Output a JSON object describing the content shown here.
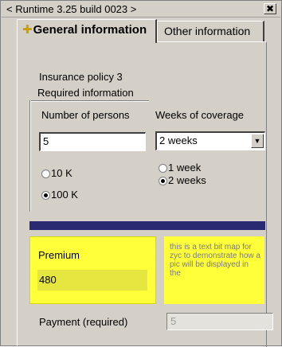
{
  "window": {
    "title": "< Runtime 3.25 build 0023 >",
    "close_label": "✖"
  },
  "tabs": [
    {
      "icon": "✚",
      "label": "General information"
    },
    {
      "label": "Other information"
    }
  ],
  "policy_name": "Insurance policy 3",
  "required_group": {
    "title": "Required information",
    "persons_label": "Number of persons",
    "weeks_label": "Weeks of coverage",
    "persons_value": "5",
    "weeks_selected": "2 weeks",
    "amount_options": [
      {
        "label": "10 K",
        "checked": false
      },
      {
        "label": "100 K",
        "checked": true
      }
    ],
    "week_options": [
      {
        "label": "1 week",
        "checked": false
      },
      {
        "label": "2 weeks",
        "checked": true
      }
    ]
  },
  "divider_color": "#2a2a72",
  "premium": {
    "label": "Premium",
    "value": "480",
    "background": "#ffff3a"
  },
  "note_text": "this is a text bit map for zyc to demonstrate how a pic will be displayed in the",
  "payment": {
    "label": "Payment (required)",
    "value": "5"
  }
}
